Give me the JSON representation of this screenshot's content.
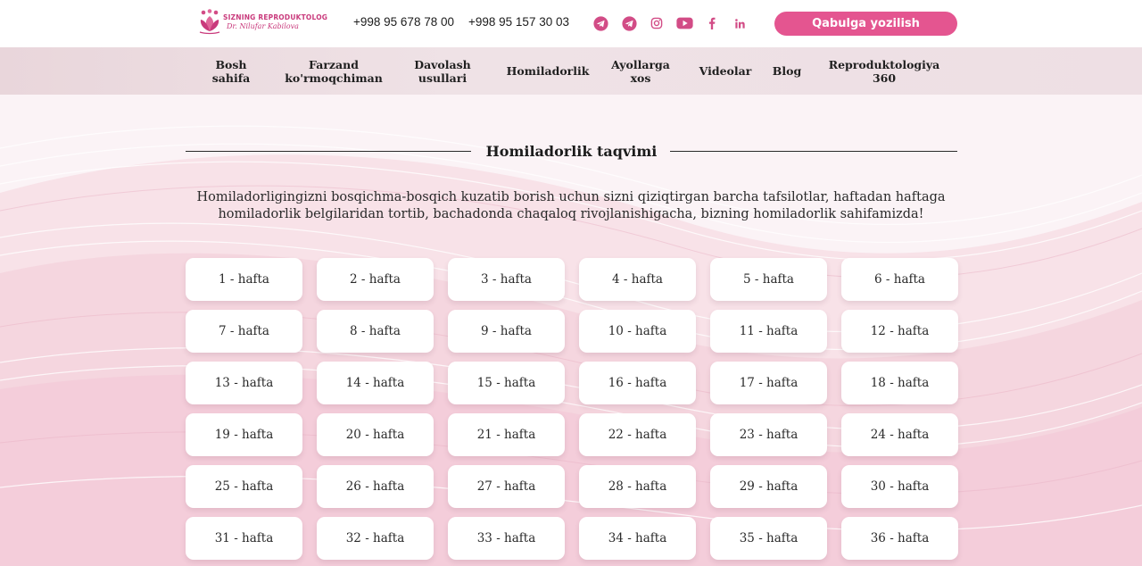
{
  "brand": {
    "line1": "SIZNING REPRODUKTOLOG",
    "line2": "Dr. Nilufar Kabilova"
  },
  "header": {
    "phone1": "+998 95 678 78 00",
    "phone2": "+998 95 157 30 03",
    "cta_label": "Qabulga yozilish",
    "socials": [
      "telegram-icon",
      "telegram-icon",
      "instagram-icon",
      "youtube-icon",
      "facebook-icon",
      "linkedin-icon"
    ],
    "accent_color": "#e45590"
  },
  "nav": {
    "items": [
      "Bosh sahifa",
      "Farzand ko'rmoqchiman",
      "Davolash usullari",
      "Homiladorlik",
      "Ayollarga xos",
      "Videolar",
      "Blog",
      "Reproduktologiya 360"
    ]
  },
  "main": {
    "title": "Homiladorlik taqvimi",
    "intro": "Homiladorligingizni bosqichma-bosqich kuzatib borish uchun sizni qiziqtirgan barcha tafsilotlar, haftadan haftaga homiladorlik belgilaridan tortib, bachadonda chaqaloq rivojlanishigacha, bizning homiladorlik sahifamizda!",
    "weeks": [
      "1 - hafta",
      "2 - hafta",
      "3 - hafta",
      "4 - hafta",
      "5 - hafta",
      "6 - hafta",
      "7 - hafta",
      "8 - hafta",
      "9 - hafta",
      "10 - hafta",
      "11 - hafta",
      "12 - hafta",
      "13 - hafta",
      "14 - hafta",
      "15 - hafta",
      "16 - hafta",
      "17 - hafta",
      "18 - hafta",
      "19 - hafta",
      "20 - hafta",
      "21 - hafta",
      "22 - hafta",
      "23 - hafta",
      "24 - hafta",
      "25 - hafta",
      "26 - hafta",
      "27 - hafta",
      "28 - hafta",
      "29 - hafta",
      "30 - hafta",
      "31 - hafta",
      "32 - hafta",
      "33 - hafta",
      "34 - hafta",
      "35 - hafta",
      "36 - hafta"
    ]
  }
}
